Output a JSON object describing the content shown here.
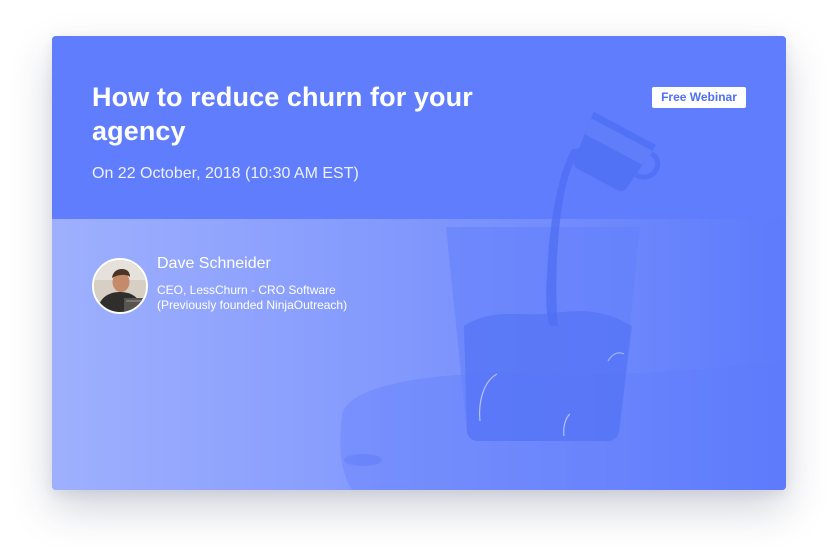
{
  "webinar": {
    "title": "How to reduce churn for your agency",
    "date": "On 22 October, 2018 (10:30 AM EST)",
    "badge": "Free Webinar"
  },
  "speaker": {
    "name": "Dave Schneider",
    "role": "CEO, LessChurn - CRO Software",
    "previously": "(Previously founded NinjaOutreach)"
  },
  "colors": {
    "header_blue": "#607dfd",
    "badge_text": "#4f6ef7",
    "gradient_left": "#9eb0fd",
    "gradient_right": "#5d7bfc"
  },
  "icons": {
    "illustration": "pouring-cup-illustration",
    "avatar": "speaker-photo"
  }
}
